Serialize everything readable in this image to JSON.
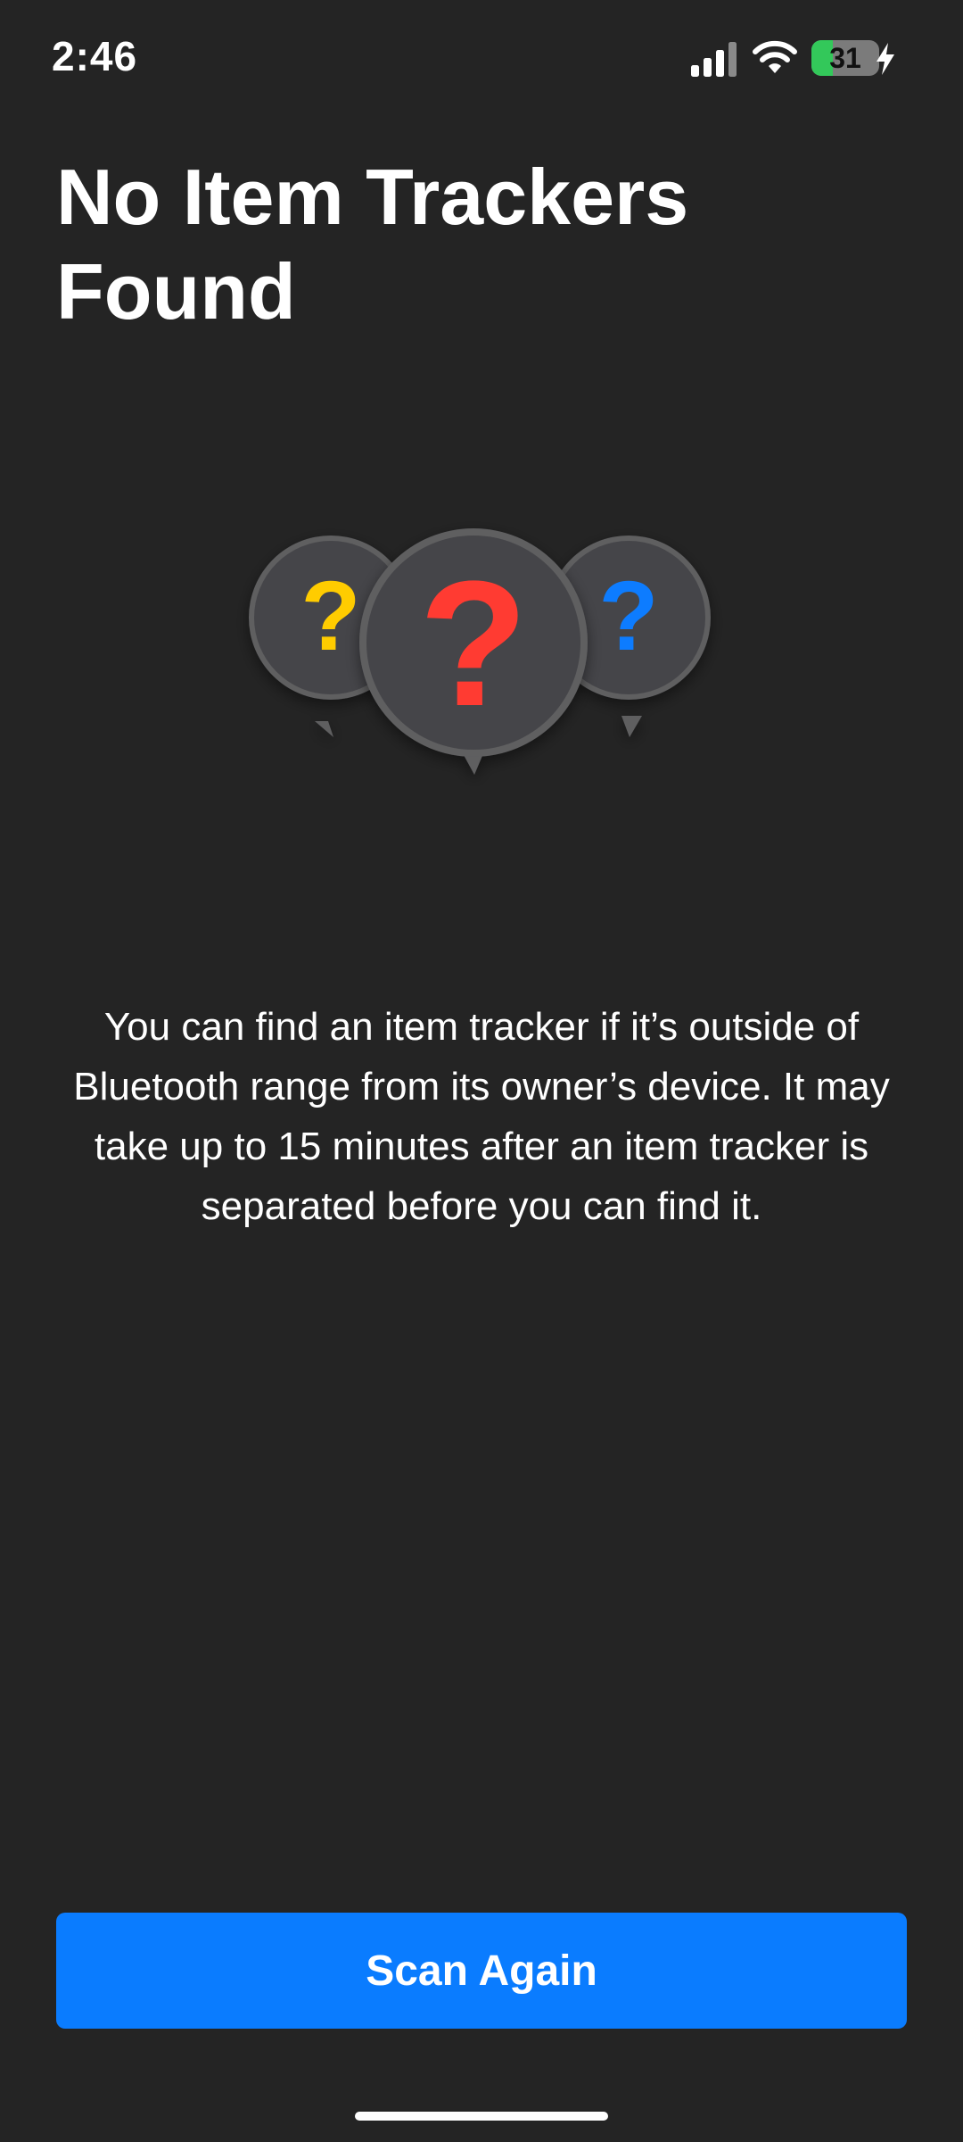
{
  "status_bar": {
    "time": "2:46",
    "battery_level": "31",
    "battery_fraction": 0.31,
    "icons": [
      "signal-icon",
      "wifi-icon",
      "battery-icon",
      "charging-icon"
    ]
  },
  "title": "No Item Trackers Found",
  "illustration": {
    "icons": [
      "question-bubble-yellow-icon",
      "question-bubble-red-icon",
      "question-bubble-blue-icon"
    ],
    "glyph": "?",
    "colors": {
      "yellow": "#ffcc00",
      "red": "#ff3b30",
      "blue": "#0a7cff",
      "bubble": "#454548",
      "bubble_border": "#5e5e60"
    }
  },
  "description": "You can find an item tracker if it’s outside of Bluetooth range from its owner’s device. It may take up to 15 minutes after an item tracker is separated before you can find it.",
  "scan_button": {
    "label": "Scan Again",
    "color": "#0a7cff"
  },
  "background_color": "#242424"
}
